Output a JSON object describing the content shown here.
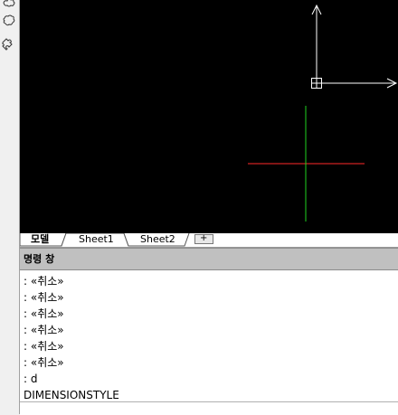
{
  "tabs": [
    {
      "label": "모델",
      "active": true
    },
    {
      "label": "Sheet1",
      "active": false
    },
    {
      "label": "Sheet2",
      "active": false
    },
    {
      "label": "+",
      "active": false
    }
  ],
  "command_window": {
    "title": "명령 창",
    "history": [
      ": «취소»",
      ": «취소»",
      ": «취소»",
      ": «취소»",
      ": «취소»",
      ": «취소»",
      ": d",
      "DIMENSIONSTYLE"
    ]
  },
  "toolbar_icons": [
    "cloud-tool-icon",
    "revcloud-icon",
    "puzzle-tool-icon"
  ],
  "colors": {
    "canvas_bg": "#000000",
    "ucs_icon": "#ffffff",
    "crosshair_x": "#ff2a2a",
    "crosshair_y": "#1fd21f"
  }
}
